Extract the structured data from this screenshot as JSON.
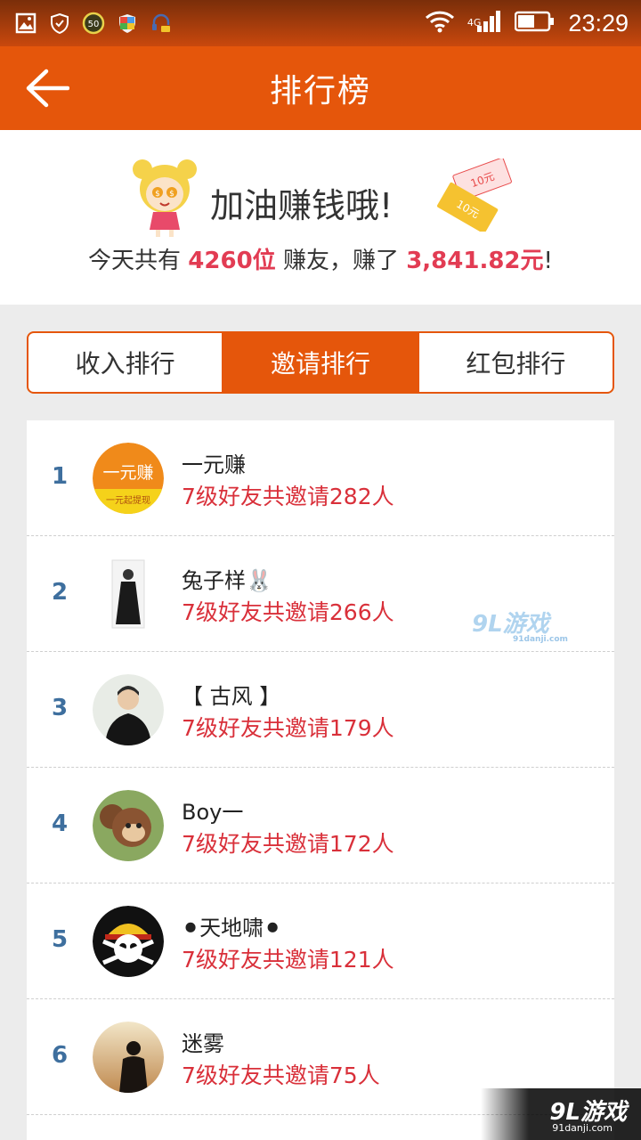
{
  "status_bar": {
    "battery_badge": "50",
    "network": "4G",
    "time": "23:29",
    "icons": [
      "image-icon",
      "shield-icon",
      "battery-saver-icon",
      "security-badge-icon",
      "headset-icon",
      "wifi-icon",
      "signal-icon",
      "battery-icon"
    ]
  },
  "app_bar": {
    "title": "排行榜",
    "back_icon": "back-arrow-icon"
  },
  "banner": {
    "motto": "加油赚钱哦!",
    "summary_prefix": "今天共有",
    "member_count": "4260位",
    "summary_middle": "赚友，赚了",
    "amount": "3,841.82元",
    "summary_suffix": "!",
    "bill_labels": [
      "10元",
      "10元"
    ]
  },
  "tabs": [
    {
      "label": "收入排行",
      "active": false
    },
    {
      "label": "邀请排行",
      "active": true
    },
    {
      "label": "红包排行",
      "active": false
    }
  ],
  "ranking": [
    {
      "rank": "1",
      "name": "一元赚",
      "invite": "7级好友共邀请282人",
      "avatar_text_top": "一元赚",
      "avatar_text_bottom": "一元起提现"
    },
    {
      "rank": "2",
      "name": "兔子样🐰",
      "invite": "7级好友共邀请266人"
    },
    {
      "rank": "3",
      "name": "【 古风 】",
      "invite": "7级好友共邀请179人"
    },
    {
      "rank": "4",
      "name": "Boy一",
      "invite": "7级好友共邀请172人"
    },
    {
      "rank": "5",
      "name": "⚫天地啸⚫",
      "invite": "7级好友共邀请121人"
    },
    {
      "rank": "6",
      "name": "迷雾",
      "invite": "7级好友共邀请75人"
    }
  ],
  "watermark": {
    "logo": "9L游戏",
    "url": "91danji.com"
  },
  "colors": {
    "brand_orange": "#e5560b",
    "highlight_red": "#e23c53",
    "invite_red": "#d9303a",
    "rank_blue": "#3e6f9e"
  }
}
